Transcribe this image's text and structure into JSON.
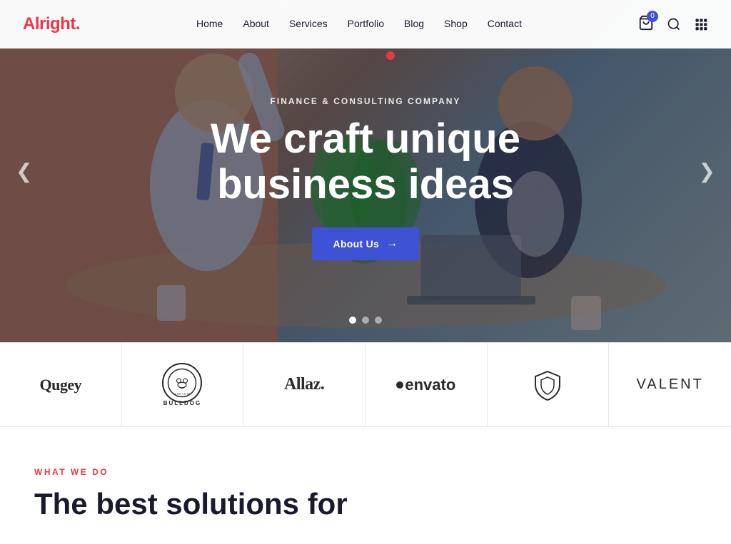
{
  "brand": {
    "name": "Alright",
    "dot": "."
  },
  "nav": {
    "items": [
      {
        "label": "Home",
        "href": "#"
      },
      {
        "label": "About",
        "href": "#"
      },
      {
        "label": "Services",
        "href": "#"
      },
      {
        "label": "Portfolio",
        "href": "#"
      },
      {
        "label": "Blog",
        "href": "#"
      },
      {
        "label": "Shop",
        "href": "#"
      },
      {
        "label": "Contact",
        "href": "#"
      }
    ],
    "cart_count": "0"
  },
  "hero": {
    "subtitle": "Finance & Consulting Company",
    "title_line1": "We craft unique",
    "title_line2": "business ideas",
    "cta_label": "About Us",
    "dots": [
      "active",
      "",
      ""
    ],
    "arrow_left": "❮",
    "arrow_right": "❯"
  },
  "logos": [
    {
      "id": "qugey",
      "text": "Qugey",
      "style": "serif"
    },
    {
      "id": "bulldog",
      "text": "BULLDOG",
      "style": "circle"
    },
    {
      "id": "allaz",
      "text": "Allaz.",
      "style": "normal"
    },
    {
      "id": "envato",
      "text": "envato",
      "style": "dot"
    },
    {
      "id": "shield",
      "text": "shield",
      "style": "icon"
    },
    {
      "id": "valent",
      "text": "VALENT",
      "style": "light"
    }
  ],
  "wwd": {
    "label": "What We Do",
    "title_line1": "The best solutions for"
  }
}
